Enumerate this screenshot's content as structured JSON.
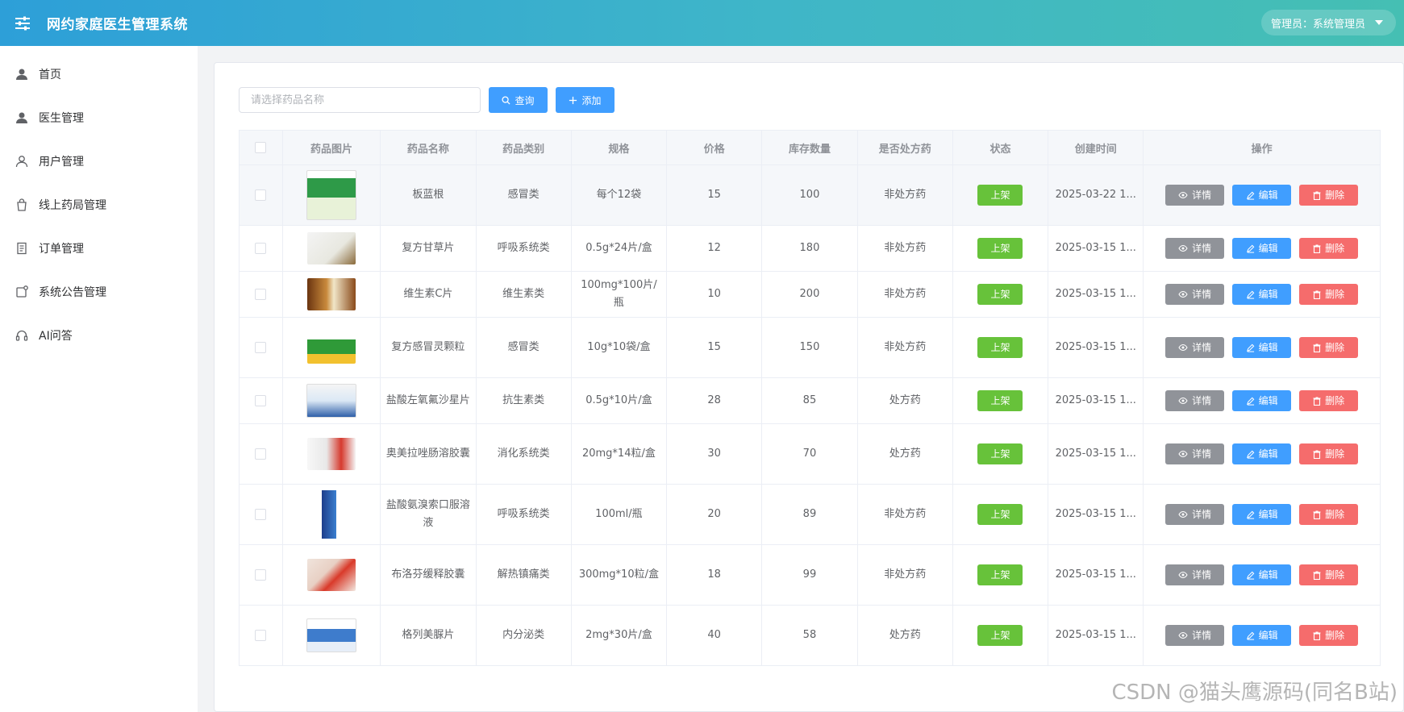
{
  "app": {
    "title": "网约家庭医生管理系统"
  },
  "header": {
    "user_label": "管理员：系统管理员"
  },
  "sidebar": {
    "items": [
      {
        "label": "首页",
        "icon": "user-filled-icon"
      },
      {
        "label": "医生管理",
        "icon": "user-filled-icon"
      },
      {
        "label": "用户管理",
        "icon": "user-outline-icon"
      },
      {
        "label": "线上药局管理",
        "icon": "shopping-bag-icon"
      },
      {
        "label": "订单管理",
        "icon": "document-icon"
      },
      {
        "label": "系统公告管理",
        "icon": "notification-icon"
      },
      {
        "label": "AI问答",
        "icon": "headset-icon"
      }
    ]
  },
  "search": {
    "placeholder": "请选择药品名称",
    "value": ""
  },
  "toolbar": {
    "query_label": "查询",
    "add_label": "添加"
  },
  "table": {
    "columns": [
      "药品图片",
      "药品名称",
      "药品类别",
      "规格",
      "价格",
      "库存数量",
      "是否处方药",
      "状态",
      "创建时间",
      "操作"
    ],
    "action_labels": {
      "detail": "详情",
      "edit": "编辑",
      "delete": "删除"
    },
    "rows": [
      {
        "name": "板蓝根",
        "category": "感冒类",
        "spec": "每个12袋",
        "price": "15",
        "stock": "100",
        "rx": "非处方药",
        "status": "上架",
        "created": "2025-03-22 1..."
      },
      {
        "name": "复方甘草片",
        "category": "呼吸系统类",
        "spec": "0.5g*24片/盒",
        "price": "12",
        "stock": "180",
        "rx": "非处方药",
        "status": "上架",
        "created": "2025-03-15 1..."
      },
      {
        "name": "维生素C片",
        "category": "维生素类",
        "spec": "100mg*100片/瓶",
        "price": "10",
        "stock": "200",
        "rx": "非处方药",
        "status": "上架",
        "created": "2025-03-15 1..."
      },
      {
        "name": "复方感冒灵颗粒",
        "category": "感冒类",
        "spec": "10g*10袋/盒",
        "price": "15",
        "stock": "150",
        "rx": "非处方药",
        "status": "上架",
        "created": "2025-03-15 1..."
      },
      {
        "name": "盐酸左氧氟沙星片",
        "category": "抗生素类",
        "spec": "0.5g*10片/盒",
        "price": "28",
        "stock": "85",
        "rx": "处方药",
        "status": "上架",
        "created": "2025-03-15 1..."
      },
      {
        "name": "奥美拉唑肠溶胶囊",
        "category": "消化系统类",
        "spec": "20mg*14粒/盒",
        "price": "30",
        "stock": "70",
        "rx": "处方药",
        "status": "上架",
        "created": "2025-03-15 1..."
      },
      {
        "name": "盐酸氨溴索口服溶液",
        "category": "呼吸系统类",
        "spec": "100ml/瓶",
        "price": "20",
        "stock": "89",
        "rx": "非处方药",
        "status": "上架",
        "created": "2025-03-15 1..."
      },
      {
        "name": "布洛芬缓释胶囊",
        "category": "解热镇痛类",
        "spec": "300mg*10粒/盒",
        "price": "18",
        "stock": "99",
        "rx": "非处方药",
        "status": "上架",
        "created": "2025-03-15 1..."
      },
      {
        "name": "格列美脲片",
        "category": "内分泌类",
        "spec": "2mg*30片/盒",
        "price": "40",
        "stock": "58",
        "rx": "处方药",
        "status": "上架",
        "created": "2025-03-15 1..."
      }
    ]
  },
  "watermark": "CSDN @猫头鹰源码(同名B站)",
  "colors": {
    "primary": "#409eff",
    "success": "#67c23a",
    "danger": "#f56c6c",
    "info": "#909399"
  }
}
